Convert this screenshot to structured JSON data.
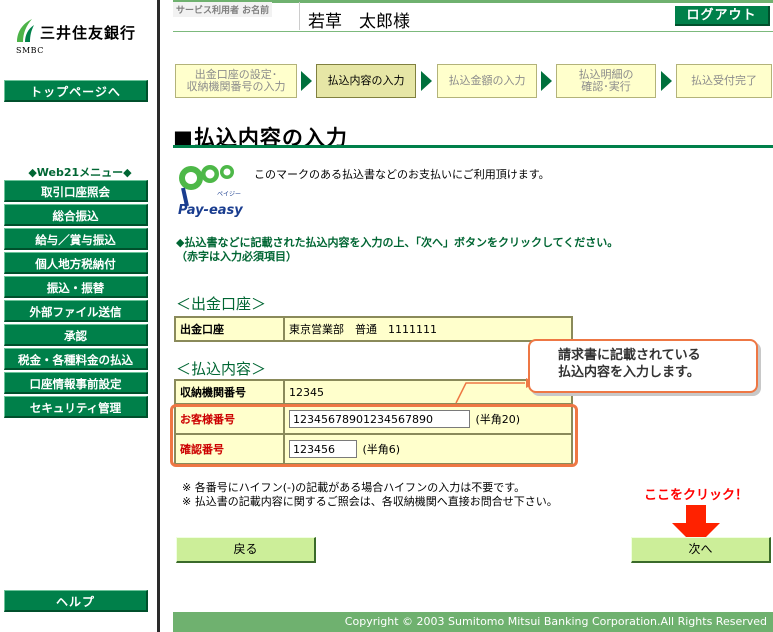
{
  "sidebar": {
    "logo_name": "三井住友銀行",
    "logo_abbr": "SMBC",
    "top_button": "トップページへ",
    "menu_heading": "◆Web21メニュー◆",
    "menu_items": [
      "取引口座照会",
      "総合振込",
      "給与／賞与振込",
      "個人地方税納付",
      "振込・振替",
      "外部ファイル送信",
      "承認",
      "税金・各種料金の払込",
      "口座情報事前設定",
      "セキュリティ管理"
    ],
    "help_button": "ヘルプ"
  },
  "header": {
    "user_label": "サービス利用者 お名前",
    "user_name": "若草　太郎様",
    "logout_label": "ログアウト"
  },
  "steps": [
    {
      "line1": "出金口座の設定･",
      "line2": "収納機関番号の入力",
      "active": false
    },
    {
      "line1": "払込内容の入力",
      "line2": "",
      "active": true
    },
    {
      "line1": "払込金額の入力",
      "line2": "",
      "active": false
    },
    {
      "line1": "払込明細の",
      "line2": "確認･実行",
      "active": false
    },
    {
      "line1": "払込受付完了",
      "line2": "",
      "active": false
    }
  ],
  "page_title": "■払込内容の入力",
  "payeasy": {
    "logo_text": "Pay-easy",
    "logo_kana": "ペイジー",
    "description": "このマークのある払込書などのお支払いにご利用頂けます。"
  },
  "instruction": {
    "line1": "◆払込書などに記載された払込内容を入力の上、「次へ」ボタンをクリックしてください。",
    "line2": "（赤字は入力必須項目）"
  },
  "withdrawal_section": {
    "heading": "＜出金口座＞",
    "label": "出金口座",
    "value": "東京営業部　普通　1111111"
  },
  "payment_section": {
    "heading": "＜払込内容＞",
    "receiving_label": "収納機関番号",
    "receiving_value": "12345",
    "customer_label": "お客様番号",
    "customer_value": "12345678901234567890",
    "customer_hint": "(半角20)",
    "confirm_label": "確認番号",
    "confirm_value": "123456",
    "confirm_hint": "(半角6)"
  },
  "callout": {
    "line1": "請求書に記載されている",
    "line2": "払込内容を入力します。"
  },
  "notes": [
    "※ 各番号にハイフン(-)の記載がある場合ハイフンの入力は不要です。",
    "※ 払込書の記載内容に関するご照会は、各収納機関へ直接お問合せ下さい。"
  ],
  "click_here": "ここをクリック！",
  "buttons": {
    "back": "戻る",
    "next": "次へ"
  },
  "footer": "Copyright © 2003 Sumitomo Mitsui Banking Corporation.All Rights Reserved",
  "colors": {
    "brand_green": "#00804a",
    "highlight_orange": "#ee7744",
    "required_red": "#cc0000"
  }
}
